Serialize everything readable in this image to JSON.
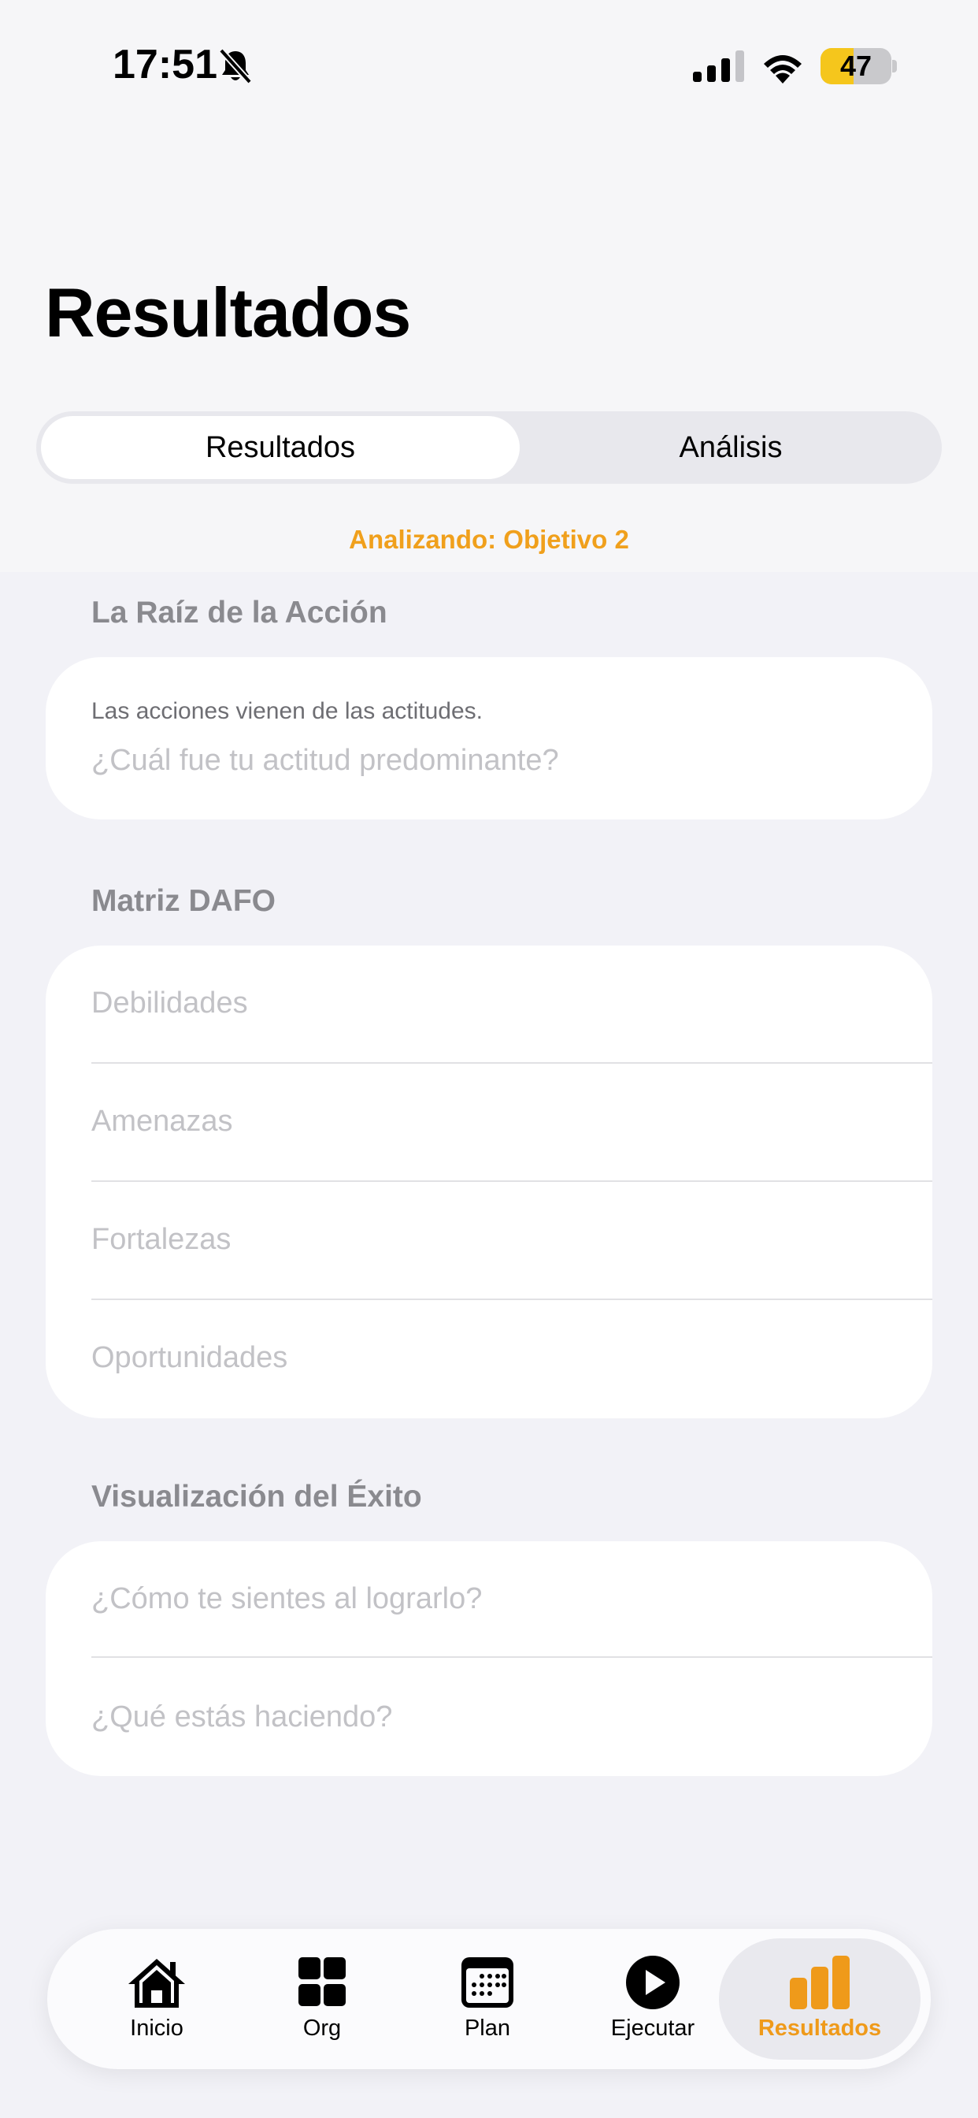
{
  "status_bar": {
    "time": "17:51",
    "battery_percent": "47",
    "battery_level": 0.47,
    "icons": [
      "bell-slash-icon",
      "cellular-signal-icon",
      "wifi-icon",
      "battery-icon"
    ]
  },
  "header": {
    "title": "Resultados"
  },
  "segmented_control": {
    "selected": "Resultados",
    "segments": [
      "Resultados",
      "Análisis"
    ]
  },
  "analyzing_label": "Analizando: Objetivo 2",
  "sections": {
    "root": {
      "title": "La Raíz de la Acción",
      "note": "Las acciones vienen de las actitudes.",
      "placeholder": "¿Cuál fue tu actitud predominante?"
    },
    "dafo": {
      "title": "Matriz DAFO",
      "fields": [
        "Debilidades",
        "Amenazas",
        "Fortalezas",
        "Oportunidades"
      ]
    },
    "success": {
      "title": "Visualización del Éxito",
      "fields": [
        "¿Cómo te sientes al lograrlo?",
        "¿Qué estás haciendo?"
      ]
    }
  },
  "tab_bar": {
    "active": "Resultados",
    "tabs": [
      {
        "label": "Inicio",
        "icon": "house-icon"
      },
      {
        "label": "Org",
        "icon": "grid-icon"
      },
      {
        "label": "Plan",
        "icon": "calendar-icon"
      },
      {
        "label": "Ejecutar",
        "icon": "play-circle-icon"
      },
      {
        "label": "Resultados",
        "icon": "bar-chart-icon"
      }
    ]
  },
  "colors": {
    "accent": "#ef9a1a",
    "battery": "#f5c61c",
    "background": "#f2f2f7"
  }
}
